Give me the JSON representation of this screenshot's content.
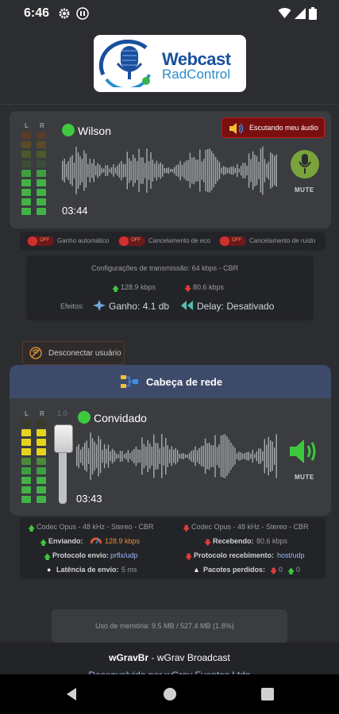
{
  "status_bar": {
    "time": "6:46"
  },
  "logo": {
    "line1": "Webcast",
    "line2": "RadControl"
  },
  "local": {
    "meter_labels": [
      "L",
      "R"
    ],
    "name": "Wilson",
    "timer": "03:44",
    "mute_label": "MUTE",
    "listen_button": "Escutando meu áudio",
    "toggles": [
      {
        "state": "OFF",
        "label": "Ganho automático"
      },
      {
        "state": "OFF",
        "label": "Cancelamento de eco"
      },
      {
        "state": "OFF",
        "label": "Cancelamento de ruído"
      }
    ],
    "transmission_config": "Configurações de transmissão: 64 kbps - CBR",
    "up_rate": "128.9 kbps",
    "down_rate": "80.6 kbps",
    "effects_label": "Efeitos:",
    "gain": "Ganho: 4.1 db",
    "delay": "Delay: Desativado"
  },
  "disconnect_button": "Desconectar usuário",
  "network": {
    "header": "Cabeça de rede",
    "meter_labels": [
      "L",
      "R"
    ],
    "volume_value": "1.0",
    "name": "Convidado",
    "timer": "03:43",
    "mute_label": "MUTE",
    "codec_send": "Codec Opus - 48 kHz - Stereo - CBR",
    "codec_recv": "Codec Opus - 48 kHz - Stereo - CBR",
    "sent_label": "Enviando:",
    "sent_value": "128.9 kbps",
    "recv_label": "Recebendo:",
    "recv_value": "80.6 kbps",
    "proto_send_label": "Protocolo envio:",
    "proto_send_value": "prflx/udp",
    "proto_recv_label": "Protocolo recebimento:",
    "proto_recv_value": "host/udp",
    "latency_label": "Latência de envio:",
    "latency_value": "5 ms",
    "lost_label": "Pacotes perdidos:",
    "lost_down": "0",
    "lost_up": "0"
  },
  "memory": "Uso de memória: 9.5 MB / 527.4 MB (1.8%)",
  "footer": {
    "brand": "wGravBr",
    "text": " - wGrav Broadcast",
    "cut": "Desenvolvido por wGrav Eventos Ltda"
  },
  "colors": {
    "accent_green": "#3ec83e",
    "danger_red": "#7a0f0f",
    "header_blue": "#3d4a6a",
    "link_blue": "#9fb6ff"
  }
}
